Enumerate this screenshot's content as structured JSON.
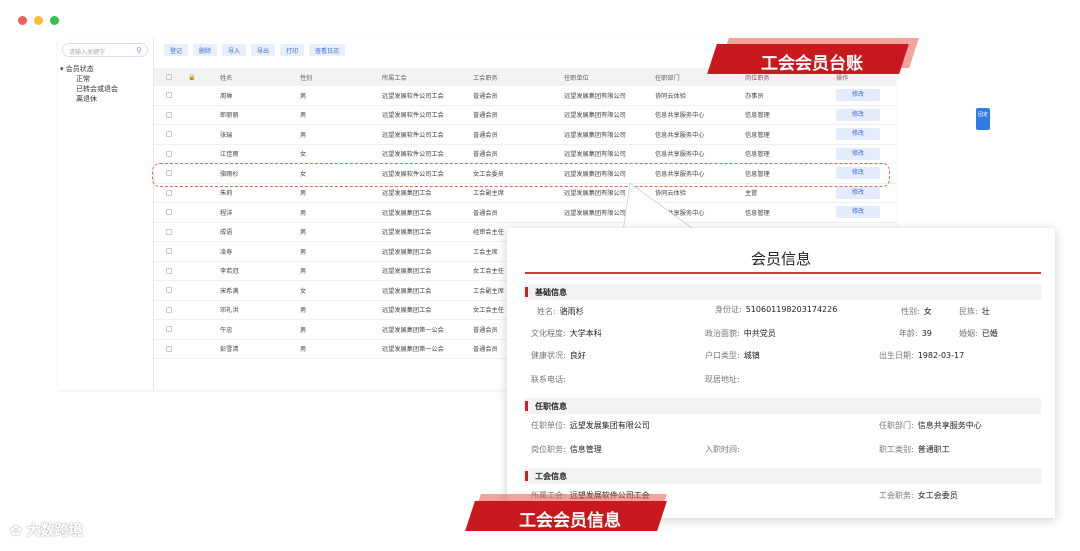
{
  "sidebar": {
    "search_placeholder": "请输入关键字",
    "tree_root": "会员状态",
    "tree_children": [
      "正常",
      "已转会或退会",
      "离退休"
    ]
  },
  "toolbar": [
    "登记",
    "删除",
    "导入",
    "导出",
    "打印",
    "查看日志"
  ],
  "table": {
    "headers": [
      "姓名",
      "性别",
      "所属工会",
      "工会职务",
      "任职单位",
      "任职部门",
      "岗位职务",
      "操作"
    ],
    "rows": [
      [
        "周琳",
        "男",
        "远望发展软件公司工会",
        "普通会员",
        "远望发展集团有限公司",
        "协同云体验",
        "办事员",
        "修改"
      ],
      [
        "郎丽丽",
        "男",
        "远望发展软件公司工会",
        "普通会员",
        "远望发展集团有限公司",
        "信息共享服务中心",
        "信息管理",
        "修改"
      ],
      [
        "张瑞",
        "男",
        "远望发展软件公司工会",
        "普通会员",
        "远望发展集团有限公司",
        "信息共享服务中心",
        "信息管理",
        "修改"
      ],
      [
        "江佳雨",
        "女",
        "远望发展软件公司工会",
        "普通会员",
        "远望发展集团有限公司",
        "信息共享服务中心",
        "信息管理",
        "修改"
      ],
      [
        "骆雨杉",
        "女",
        "远望发展软件公司工会",
        "女工会委员",
        "远望发展集团有限公司",
        "信息共享服务中心",
        "信息管理",
        "修改"
      ],
      [
        "朱莉",
        "男",
        "远望发展集团工会",
        "工会副主席",
        "远望发展集团有限公司",
        "协同云体验",
        "主管",
        "修改"
      ],
      [
        "程洋",
        "男",
        "远望发展集团工会",
        "普通会员",
        "远望发展集团有限公司",
        "信息共享服务中心",
        "信息管理",
        "修改"
      ],
      [
        "成语",
        "男",
        "远望发展集团工会",
        "经审会主任",
        "",
        "",
        "",
        ""
      ],
      [
        "凌寿",
        "男",
        "远望发展集团工会",
        "工会主席",
        "",
        "",
        "",
        ""
      ],
      [
        "李若冠",
        "男",
        "远望发展集团工会",
        "女工会主任",
        "",
        "",
        "",
        ""
      ],
      [
        "宋希满",
        "女",
        "远望发展集团工会",
        "工会副主席",
        "",
        "",
        "",
        ""
      ],
      [
        "邓礼洪",
        "男",
        "远望发展集团工会",
        "女工会主任",
        "",
        "",
        "",
        ""
      ],
      [
        "午忠",
        "男",
        "远望发展集团第一公会",
        "普通会员",
        "",
        "",
        "",
        ""
      ],
      [
        "彭雪清",
        "男",
        "远望发展集团第一公会",
        "普通会员",
        "",
        "",
        "",
        ""
      ]
    ],
    "fix_tag": "固定"
  },
  "banners": {
    "ledger": "工会会员台账",
    "info": "工会会员信息"
  },
  "popup": {
    "title": "会员信息",
    "sections": [
      "基础信息",
      "任职信息",
      "工会信息"
    ],
    "basic": {
      "name_label": "姓名:",
      "name": "骆雨杉",
      "id_label": "身份证:",
      "id": "510601198203174226",
      "gender_label": "性别:",
      "gender": "女",
      "ethnic_label": "民族:",
      "ethnic": "壮",
      "edu_label": "文化程度:",
      "edu": "大学本科",
      "politics_label": "政治面貌:",
      "politics": "中共党员",
      "age_label": "年龄:",
      "age": "39",
      "marital_label": "婚姻:",
      "marital": "已婚",
      "health_label": "健康状况:",
      "health": "良好",
      "hukou_label": "户口类型:",
      "hukou": "城镇",
      "birth_label": "出生日期:",
      "birth": "1982-03-17",
      "phone_label": "联系电话:",
      "addr_label": "现居地址:"
    },
    "job": {
      "unit_label": "任职单位:",
      "unit": "远望发展集团有限公司",
      "dept_label": "任职部门:",
      "dept": "信息共享服务中心",
      "post_label": "岗位职务:",
      "post": "信息管理",
      "entry_label": "入职时间:",
      "type_label": "职工类别:",
      "type": "普通职工"
    },
    "union": {
      "union_label": "所属工会:",
      "union": "远望发展软件公司工会",
      "role_label": "工会职务:",
      "role": "女工会委员"
    }
  },
  "watermark": "大数跨境",
  "colors": {
    "accent_red": "#c9191e",
    "accent_blue": "#3a6fd8"
  }
}
